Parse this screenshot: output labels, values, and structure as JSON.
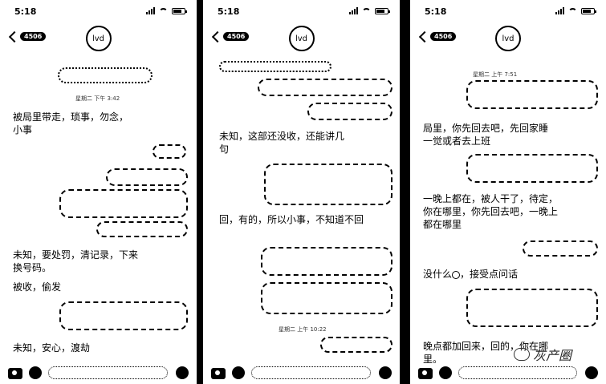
{
  "status": {
    "time": "5:18"
  },
  "nav": {
    "badge": "4506",
    "avatar": "lvd"
  },
  "panels": [
    {
      "timestamps": [
        "星期二 下午 3:42"
      ],
      "messages": [
        "被局里带走，琐事，勿念，小事",
        "未知，要处罚，清记录，下来换号码。",
        "被收，偷发",
        "未知，安心，渡劫"
      ]
    },
    {
      "timestamps": [
        "星期二 上午 10:22"
      ],
      "messages": [
        "未知，这部还没收，还能讲几句",
        "回，有的，所以小事，不知道不回"
      ]
    },
    {
      "timestamps": [
        "星期二 上午 7:51"
      ],
      "messages": [
        "局里，你先回去吧，先回家睡一觉或者去上班",
        "一晚上都在，被人干了，待定，你在哪里，你先回去吧，一晚上都在哪里",
        "没什么",
        "，接受点问话",
        "晚点都加回来，回的，你在哪里。"
      ]
    }
  ],
  "watermark": "灰产圈"
}
